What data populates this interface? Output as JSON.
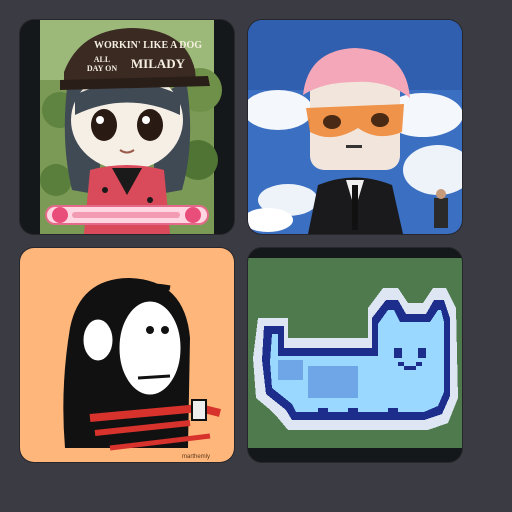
{
  "grid": {
    "items": [
      {
        "icon": "anime-avatar-cap-icon",
        "cap_line1": "WORKIN' LIKE A DOG",
        "cap_line2": "ALL",
        "cap_line3": "DAY ON",
        "cap_brand": "MILADY"
      },
      {
        "icon": "pink-hair-avatar-icon"
      },
      {
        "icon": "headphones-stick-figure-icon",
        "signature": "marthemly"
      },
      {
        "icon": "pixel-cat-icon"
      }
    ]
  },
  "colors": {
    "page_background": "#3b3b44",
    "tile3_background": "#ffb67a",
    "tile4_background": "#4e7a4e",
    "cat_fill": "#9ad8ff",
    "cat_outline": "#1c2d8c"
  }
}
